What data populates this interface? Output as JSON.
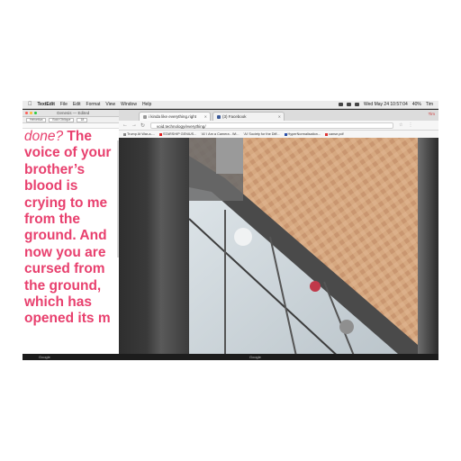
{
  "menubar": {
    "app_name": "TextEdit",
    "menus": [
      "File",
      "Edit",
      "Format",
      "View",
      "Window",
      "Help"
    ],
    "datetime": "Wed May 24  10:57:04",
    "battery": "40%",
    "user": "Tim"
  },
  "textedit": {
    "window_title": "Genesis — Edited",
    "font_name": "Helvetica",
    "font_style": "Bold Oblique",
    "font_size": "18",
    "lines": [
      {
        "text": "done?",
        "italic": true,
        "rest": " The"
      },
      {
        "text": "voice of your"
      },
      {
        "text": "brother’s"
      },
      {
        "text": "blood is"
      },
      {
        "text": "crying to me"
      },
      {
        "text": "from the"
      },
      {
        "text": "ground. And"
      },
      {
        "text": "now you are"
      },
      {
        "text": "cursed from"
      },
      {
        "text": "the ground,"
      },
      {
        "text": "which has"
      },
      {
        "text": "opened its m"
      }
    ],
    "text_color": "#e8406e"
  },
  "chrome": {
    "tabs": [
      {
        "label": "i kinda like everything.right",
        "favicon_color": "#999999",
        "active": true
      },
      {
        "label": "(3) Facebook",
        "favicon_color": "#3b5998",
        "active": false
      }
    ],
    "url": "void.technology/everything/",
    "profile_name": "Tim",
    "bookmarks": [
      "Trump At War-a-...",
      "STARSHIP GENIUS...",
      "'Ai' I Am a Camera - Wi...",
      "'Ai' Society for the Diff...",
      "HyperNormalisation...",
      "canse.pdf"
    ]
  },
  "taskbar": {
    "left_label": "Google",
    "right_label": "Google"
  }
}
